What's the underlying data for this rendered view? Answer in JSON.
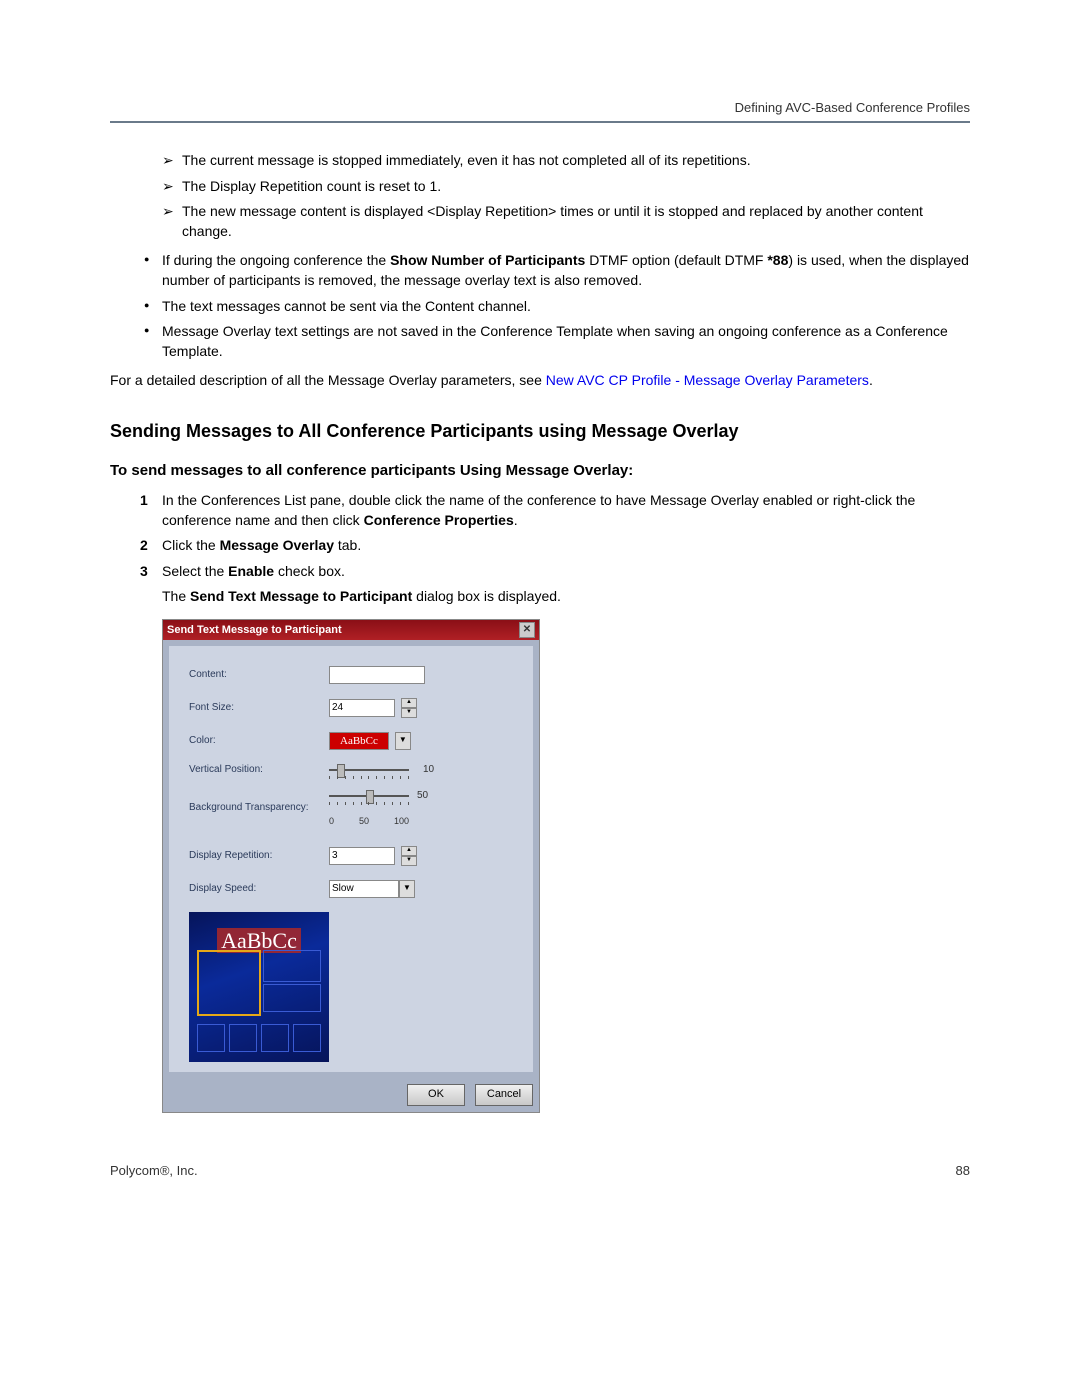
{
  "header": {
    "right": "Defining AVC-Based Conference Profiles"
  },
  "arrow_items": [
    "The current message is stopped immediately, even it has not completed all of its repetitions.",
    "The Display Repetition count is reset to 1.",
    "The new message content is displayed <Display Repetition> times or until it is stopped and replaced by another content change."
  ],
  "bullets": {
    "b1_pre": "If during the ongoing conference the ",
    "b1_bold1": "Show Number of Participants",
    "b1_mid": " DTMF option (default DTMF ",
    "b1_bold2": "*88",
    "b1_post": ") is used, when the displayed number of participants is removed, the message overlay text is also removed.",
    "b2": "The text messages cannot be sent via the Content channel.",
    "b3": "Message Overlay text settings are not saved in the Conference Template when saving an ongoing conference as a Conference Template."
  },
  "para_detail_pre": "For a detailed description of all the Message Overlay parameters, see ",
  "para_detail_link": "New AVC CP Profile - Message Overlay Parameters",
  "para_detail_post": ".",
  "h2": "Sending Messages to All Conference Participants using Message Overlay",
  "h3": "To send messages to all conference participants Using Message Overlay:",
  "steps": {
    "s1_pre": "In the Conferences List pane, double click the name of the conference to have Message Overlay enabled or right-click the conference name and then click ",
    "s1_bold": "Conference Properties",
    "s1_post": ".",
    "s2_pre": "Click the ",
    "s2_bold": "Message Overlay",
    "s2_post": " tab.",
    "s3_pre": "Select the ",
    "s3_bold": "Enable",
    "s3_post": " check box.",
    "s_after_pre": "The ",
    "s_after_bold": "Send Text Message to Participant",
    "s_after_post": " dialog box is displayed."
  },
  "dialog": {
    "title": "Send Text Message to Participant",
    "labels": {
      "content": "Content:",
      "font_size": "Font Size:",
      "color": "Color:",
      "vpos": "Vertical Position:",
      "bgtrans": "Background Transparency:",
      "reps": "Display Repetition:",
      "speed": "Display Speed:"
    },
    "values": {
      "content": "",
      "font_size": "24",
      "color_sample": "AaBbCc",
      "vpos": "10",
      "bgtrans": "50",
      "bgtrans_ticks": [
        "0",
        "50",
        "100"
      ],
      "reps": "3",
      "speed": "Slow"
    },
    "preview_text": "AaBbCc",
    "buttons": {
      "ok": "OK",
      "cancel": "Cancel"
    }
  },
  "footer": {
    "left": "Polycom®, Inc.",
    "right": "88"
  }
}
